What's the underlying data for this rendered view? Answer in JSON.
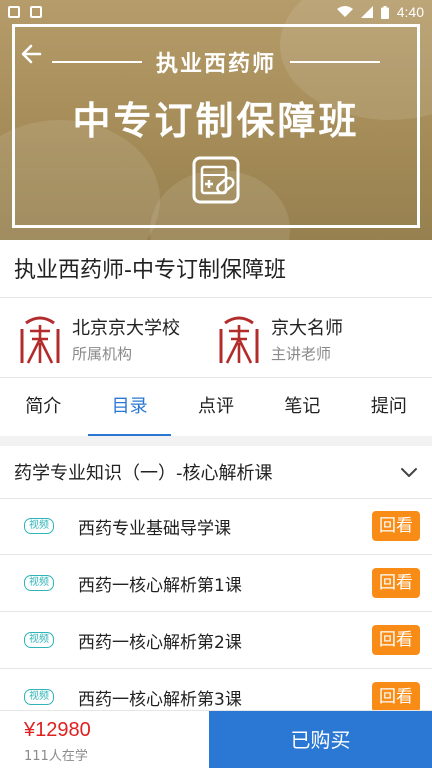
{
  "status_bar": {
    "time": "4:40"
  },
  "hero": {
    "subtitle": "执业西药师",
    "title": "中专订制保障班"
  },
  "course": {
    "title": "执业西药师-中专订制保障班"
  },
  "institution": {
    "name": "北京京大学校",
    "role": "所属机构"
  },
  "teacher": {
    "name": "京大名师",
    "role": "主讲老师"
  },
  "tabs": [
    {
      "label": "简介"
    },
    {
      "label": "目录",
      "active": true
    },
    {
      "label": "点评"
    },
    {
      "label": "笔记"
    },
    {
      "label": "提问"
    }
  ],
  "chapter": {
    "title": "药学专业知识（一）-核心解析课"
  },
  "lessons": [
    {
      "badge": "视频",
      "title": "西药专业基础导学课",
      "action": "回看"
    },
    {
      "badge": "视频",
      "title": "西药一核心解析第1课",
      "action": "回看"
    },
    {
      "badge": "视频",
      "title": "西药一核心解析第2课",
      "action": "回看"
    },
    {
      "badge": "视频",
      "title": "西药一核心解析第3课",
      "action": "回看"
    }
  ],
  "bottom_bar": {
    "price": "¥12980",
    "learners": "111人在学",
    "buy_label": "已购买"
  },
  "colors": {
    "accent": "#2a78d4",
    "replay": "#f98c16",
    "price": "#e02020",
    "badge": "#2fb4b8",
    "logo": "#b32c2c"
  },
  "icons": [
    "back-arrow-icon",
    "chevron-down-icon",
    "video-badge-icon",
    "pharmacy-emblem-icon",
    "school-logo-icon",
    "wifi-icon",
    "signal-icon",
    "battery-icon"
  ]
}
